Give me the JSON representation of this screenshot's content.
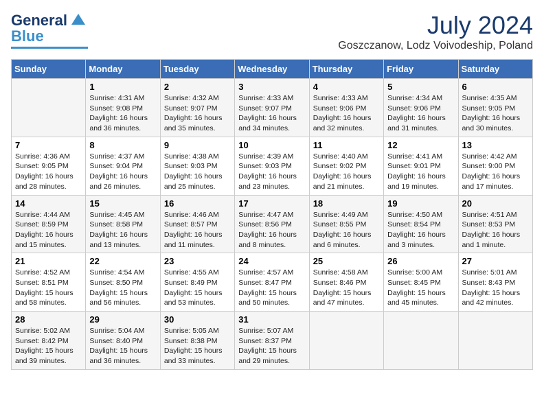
{
  "logo": {
    "line1": "General",
    "line2": "Blue"
  },
  "title": "July 2024",
  "subtitle": "Goszczanow, Lodz Voivodeship, Poland",
  "weekdays": [
    "Sunday",
    "Monday",
    "Tuesday",
    "Wednesday",
    "Thursday",
    "Friday",
    "Saturday"
  ],
  "weeks": [
    [
      {
        "day": "",
        "info": ""
      },
      {
        "day": "1",
        "info": "Sunrise: 4:31 AM\nSunset: 9:08 PM\nDaylight: 16 hours\nand 36 minutes."
      },
      {
        "day": "2",
        "info": "Sunrise: 4:32 AM\nSunset: 9:07 PM\nDaylight: 16 hours\nand 35 minutes."
      },
      {
        "day": "3",
        "info": "Sunrise: 4:33 AM\nSunset: 9:07 PM\nDaylight: 16 hours\nand 34 minutes."
      },
      {
        "day": "4",
        "info": "Sunrise: 4:33 AM\nSunset: 9:06 PM\nDaylight: 16 hours\nand 32 minutes."
      },
      {
        "day": "5",
        "info": "Sunrise: 4:34 AM\nSunset: 9:06 PM\nDaylight: 16 hours\nand 31 minutes."
      },
      {
        "day": "6",
        "info": "Sunrise: 4:35 AM\nSunset: 9:05 PM\nDaylight: 16 hours\nand 30 minutes."
      }
    ],
    [
      {
        "day": "7",
        "info": "Sunrise: 4:36 AM\nSunset: 9:05 PM\nDaylight: 16 hours\nand 28 minutes."
      },
      {
        "day": "8",
        "info": "Sunrise: 4:37 AM\nSunset: 9:04 PM\nDaylight: 16 hours\nand 26 minutes."
      },
      {
        "day": "9",
        "info": "Sunrise: 4:38 AM\nSunset: 9:03 PM\nDaylight: 16 hours\nand 25 minutes."
      },
      {
        "day": "10",
        "info": "Sunrise: 4:39 AM\nSunset: 9:03 PM\nDaylight: 16 hours\nand 23 minutes."
      },
      {
        "day": "11",
        "info": "Sunrise: 4:40 AM\nSunset: 9:02 PM\nDaylight: 16 hours\nand 21 minutes."
      },
      {
        "day": "12",
        "info": "Sunrise: 4:41 AM\nSunset: 9:01 PM\nDaylight: 16 hours\nand 19 minutes."
      },
      {
        "day": "13",
        "info": "Sunrise: 4:42 AM\nSunset: 9:00 PM\nDaylight: 16 hours\nand 17 minutes."
      }
    ],
    [
      {
        "day": "14",
        "info": "Sunrise: 4:44 AM\nSunset: 8:59 PM\nDaylight: 16 hours\nand 15 minutes."
      },
      {
        "day": "15",
        "info": "Sunrise: 4:45 AM\nSunset: 8:58 PM\nDaylight: 16 hours\nand 13 minutes."
      },
      {
        "day": "16",
        "info": "Sunrise: 4:46 AM\nSunset: 8:57 PM\nDaylight: 16 hours\nand 11 minutes."
      },
      {
        "day": "17",
        "info": "Sunrise: 4:47 AM\nSunset: 8:56 PM\nDaylight: 16 hours\nand 8 minutes."
      },
      {
        "day": "18",
        "info": "Sunrise: 4:49 AM\nSunset: 8:55 PM\nDaylight: 16 hours\nand 6 minutes."
      },
      {
        "day": "19",
        "info": "Sunrise: 4:50 AM\nSunset: 8:54 PM\nDaylight: 16 hours\nand 3 minutes."
      },
      {
        "day": "20",
        "info": "Sunrise: 4:51 AM\nSunset: 8:53 PM\nDaylight: 16 hours\nand 1 minute."
      }
    ],
    [
      {
        "day": "21",
        "info": "Sunrise: 4:52 AM\nSunset: 8:51 PM\nDaylight: 15 hours\nand 58 minutes."
      },
      {
        "day": "22",
        "info": "Sunrise: 4:54 AM\nSunset: 8:50 PM\nDaylight: 15 hours\nand 56 minutes."
      },
      {
        "day": "23",
        "info": "Sunrise: 4:55 AM\nSunset: 8:49 PM\nDaylight: 15 hours\nand 53 minutes."
      },
      {
        "day": "24",
        "info": "Sunrise: 4:57 AM\nSunset: 8:47 PM\nDaylight: 15 hours\nand 50 minutes."
      },
      {
        "day": "25",
        "info": "Sunrise: 4:58 AM\nSunset: 8:46 PM\nDaylight: 15 hours\nand 47 minutes."
      },
      {
        "day": "26",
        "info": "Sunrise: 5:00 AM\nSunset: 8:45 PM\nDaylight: 15 hours\nand 45 minutes."
      },
      {
        "day": "27",
        "info": "Sunrise: 5:01 AM\nSunset: 8:43 PM\nDaylight: 15 hours\nand 42 minutes."
      }
    ],
    [
      {
        "day": "28",
        "info": "Sunrise: 5:02 AM\nSunset: 8:42 PM\nDaylight: 15 hours\nand 39 minutes."
      },
      {
        "day": "29",
        "info": "Sunrise: 5:04 AM\nSunset: 8:40 PM\nDaylight: 15 hours\nand 36 minutes."
      },
      {
        "day": "30",
        "info": "Sunrise: 5:05 AM\nSunset: 8:38 PM\nDaylight: 15 hours\nand 33 minutes."
      },
      {
        "day": "31",
        "info": "Sunrise: 5:07 AM\nSunset: 8:37 PM\nDaylight: 15 hours\nand 29 minutes."
      },
      {
        "day": "",
        "info": ""
      },
      {
        "day": "",
        "info": ""
      },
      {
        "day": "",
        "info": ""
      }
    ]
  ]
}
